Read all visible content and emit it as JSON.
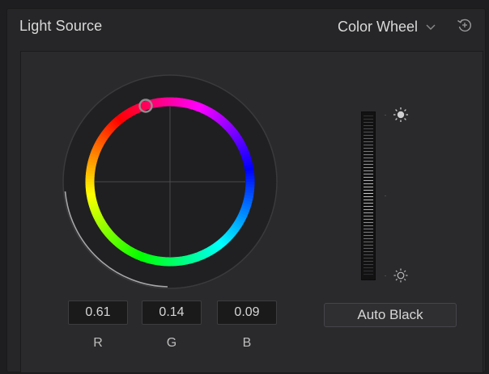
{
  "panel": {
    "title": "Light Source",
    "mode": "Color Wheel",
    "mode_icon": "chevron-down-icon",
    "reset_icon": "reset-icon"
  },
  "wheel": {
    "handle_color": "#888888"
  },
  "values": {
    "r": {
      "value": "0.61",
      "label": "R"
    },
    "g": {
      "value": "0.14",
      "label": "G"
    },
    "b": {
      "value": "0.09",
      "label": "B"
    }
  },
  "brightness": {
    "top_icon": "sun-bright-icon",
    "bottom_icon": "sun-dim-icon"
  },
  "auto_black": {
    "label": "Auto Black"
  },
  "colors": {
    "background": "#262628",
    "text": "#d6d6d6"
  }
}
